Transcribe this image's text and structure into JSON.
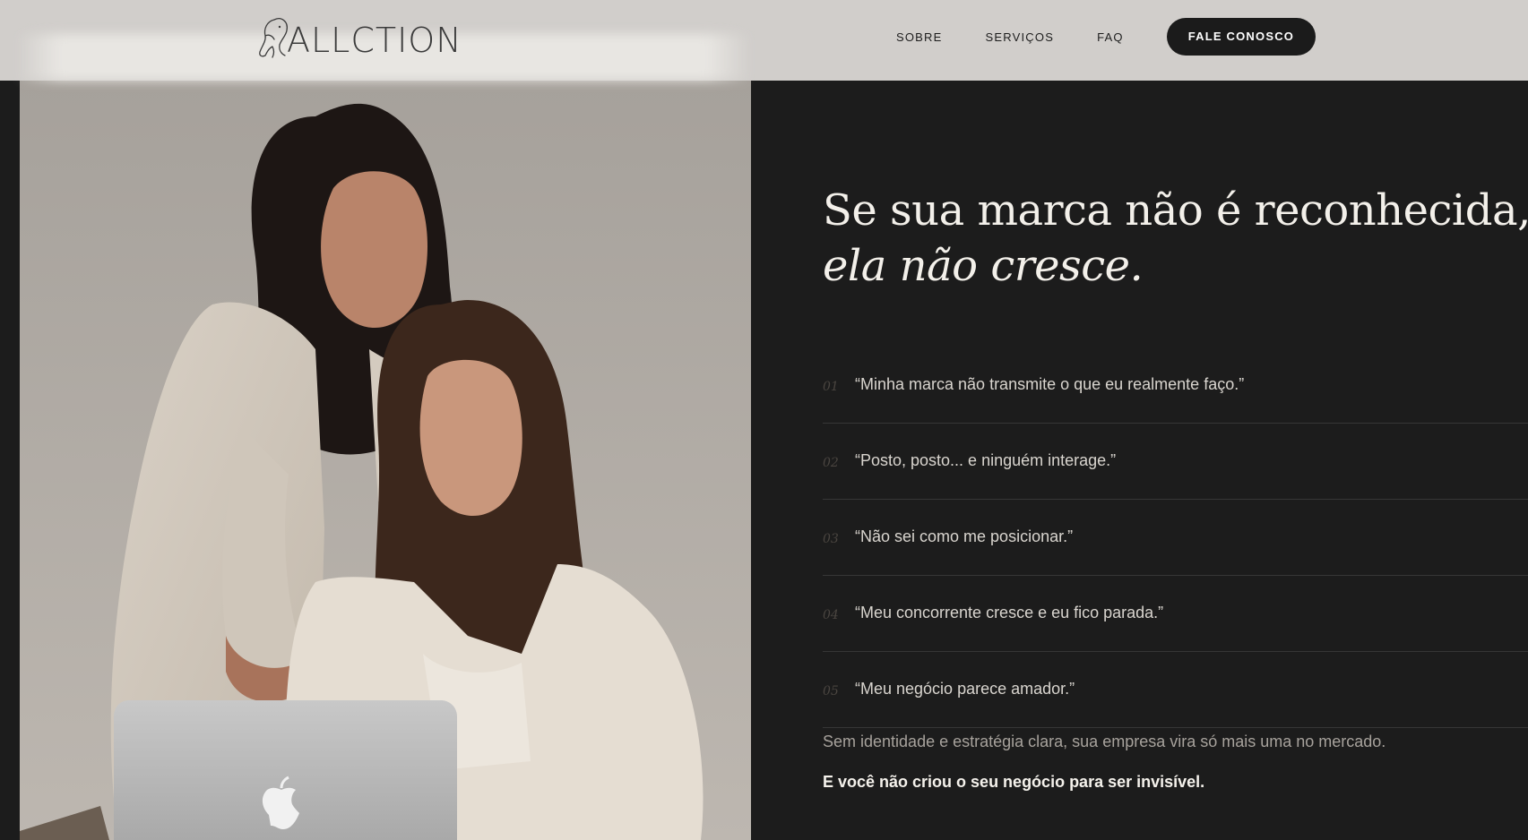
{
  "header": {
    "logo_text": "ALLCTION",
    "nav": [
      "SOBRE",
      "SERVIÇOS",
      "FAQ"
    ],
    "cta_label": "FALE CONOSCO"
  },
  "hero": {
    "headline_regular": "Se sua marca não é reconhecida, ",
    "headline_italic": "ela não cresce.",
    "pain_points": [
      {
        "num": "01",
        "text": "“Minha marca não transmite o que eu realmente faço.”"
      },
      {
        "num": "02",
        "text": "“Posto, posto... e ninguém interage.”"
      },
      {
        "num": "03",
        "text": "“Não sei como me posicionar.”"
      },
      {
        "num": "04",
        "text": "“Meu concorrente cresce e eu fico parada.”"
      },
      {
        "num": "05",
        "text": "“Meu negócio parece amador.”"
      }
    ],
    "summary": "Sem identidade e estratégia clara, sua empresa vira só mais uma no mercado.",
    "emphasis": "E você não criou o seu negócio para ser invisível."
  },
  "colors": {
    "header_bg": "#d1cecb",
    "page_bg": "#1c1c1c",
    "cta_bg": "#1b1b1b",
    "headline": "#f3f0ea"
  }
}
